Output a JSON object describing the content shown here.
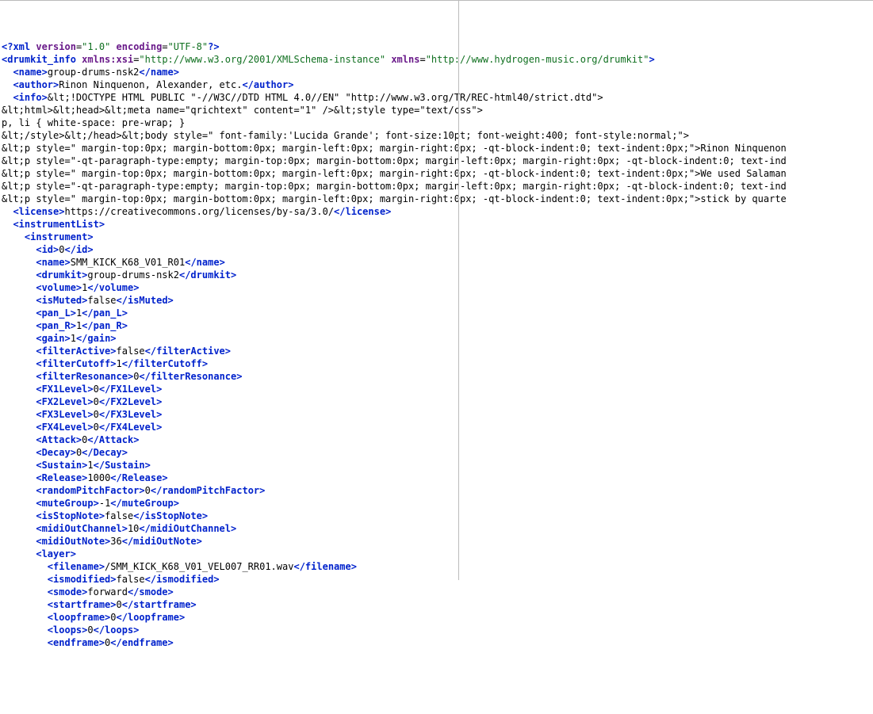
{
  "lines": [
    [
      {
        "c": "tag",
        "t": "<?xml"
      },
      {
        "c": "txt",
        "t": " "
      },
      {
        "c": "attr",
        "t": "version"
      },
      {
        "c": "txt",
        "t": "="
      },
      {
        "c": "str",
        "t": "\"1.0\""
      },
      {
        "c": "txt",
        "t": " "
      },
      {
        "c": "attr",
        "t": "encoding"
      },
      {
        "c": "txt",
        "t": "="
      },
      {
        "c": "str",
        "t": "\"UTF-8\""
      },
      {
        "c": "tag",
        "t": "?>"
      }
    ],
    [
      {
        "c": "tag",
        "t": "<drumkit_info"
      },
      {
        "c": "txt",
        "t": " "
      },
      {
        "c": "attr",
        "t": "xmlns:xsi"
      },
      {
        "c": "txt",
        "t": "="
      },
      {
        "c": "str",
        "t": "\"http://www.w3.org/2001/XMLSchema-instance\""
      },
      {
        "c": "txt",
        "t": " "
      },
      {
        "c": "attr",
        "t": "xmlns"
      },
      {
        "c": "txt",
        "t": "="
      },
      {
        "c": "str",
        "t": "\"http://www.hydrogen-music.org/drumkit\""
      },
      {
        "c": "tag",
        "t": ">"
      }
    ],
    [
      {
        "c": "txt",
        "t": "  "
      },
      {
        "c": "tag",
        "t": "<name>"
      },
      {
        "c": "txt",
        "t": "group-drums-nsk2"
      },
      {
        "c": "tag",
        "t": "</name>"
      }
    ],
    [
      {
        "c": "txt",
        "t": "  "
      },
      {
        "c": "tag",
        "t": "<author>"
      },
      {
        "c": "txt",
        "t": "Rinon Ninquenon, Alexander, etc."
      },
      {
        "c": "tag",
        "t": "</author>"
      }
    ],
    [
      {
        "c": "txt",
        "t": "  "
      },
      {
        "c": "tag",
        "t": "<info>"
      },
      {
        "c": "txt",
        "t": "&lt;!DOCTYPE HTML PUBLIC \"-//W3C//DTD HTML 4.0//EN\" \"http://www.w3.org/TR/REC-html40/strict.dtd\">"
      }
    ],
    [
      {
        "c": "txt",
        "t": "&lt;html>&lt;head>&lt;meta name=\"qrichtext\" content=\"1\" />&lt;style type=\"text/css\">"
      }
    ],
    [
      {
        "c": "txt",
        "t": "p, li { white-space: pre-wrap; }"
      }
    ],
    [
      {
        "c": "txt",
        "t": "&lt;/style>&lt;/head>&lt;body style=\" font-family:'Lucida Grande'; font-size:10pt; font-weight:400; font-style:normal;\">"
      }
    ],
    [
      {
        "c": "txt",
        "t": "&lt;p style=\" margin-top:0px; margin-bottom:0px; margin-left:0px; margin-right:0px; -qt-block-indent:0; text-indent:0px;\">Rinon Ninquenon"
      }
    ],
    [
      {
        "c": "txt",
        "t": "&lt;p style=\"-qt-paragraph-type:empty; margin-top:0px; margin-bottom:0px; margin-left:0px; margin-right:0px; -qt-block-indent:0; text-ind"
      }
    ],
    [
      {
        "c": "txt",
        "t": "&lt;p style=\" margin-top:0px; margin-bottom:0px; margin-left:0px; margin-right:0px; -qt-block-indent:0; text-indent:0px;\">We used Salaman"
      }
    ],
    [
      {
        "c": "txt",
        "t": "&lt;p style=\"-qt-paragraph-type:empty; margin-top:0px; margin-bottom:0px; margin-left:0px; margin-right:0px; -qt-block-indent:0; text-ind"
      }
    ],
    [
      {
        "c": "txt",
        "t": "&lt;p style=\" margin-top:0px; margin-bottom:0px; margin-left:0px; margin-right:0px; -qt-block-indent:0; text-indent:0px;\">stick by quarte"
      }
    ],
    [
      {
        "c": "txt",
        "t": "  "
      },
      {
        "c": "tag",
        "t": "<license>"
      },
      {
        "c": "txt",
        "t": "https://creativecommons.org/licenses/by-sa/3.0/"
      },
      {
        "c": "tag",
        "t": "</license>"
      }
    ],
    [
      {
        "c": "txt",
        "t": "  "
      },
      {
        "c": "tag",
        "t": "<instrumentList>"
      }
    ],
    [
      {
        "c": "txt",
        "t": "    "
      },
      {
        "c": "tag",
        "t": "<instrument>"
      }
    ],
    [
      {
        "c": "txt",
        "t": "      "
      },
      {
        "c": "tag",
        "t": "<id>"
      },
      {
        "c": "txt",
        "t": "0"
      },
      {
        "c": "tag",
        "t": "</id>"
      }
    ],
    [
      {
        "c": "txt",
        "t": "      "
      },
      {
        "c": "tag",
        "t": "<name>"
      },
      {
        "c": "txt",
        "t": "SMM_KICK_K68_V01_R01"
      },
      {
        "c": "tag",
        "t": "</name>"
      }
    ],
    [
      {
        "c": "txt",
        "t": "      "
      },
      {
        "c": "tag",
        "t": "<drumkit>"
      },
      {
        "c": "txt",
        "t": "group-drums-nsk2"
      },
      {
        "c": "tag",
        "t": "</drumkit>"
      }
    ],
    [
      {
        "c": "txt",
        "t": "      "
      },
      {
        "c": "tag",
        "t": "<volume>"
      },
      {
        "c": "txt",
        "t": "1"
      },
      {
        "c": "tag",
        "t": "</volume>"
      }
    ],
    [
      {
        "c": "txt",
        "t": "      "
      },
      {
        "c": "tag",
        "t": "<isMuted>"
      },
      {
        "c": "txt",
        "t": "false"
      },
      {
        "c": "tag",
        "t": "</isMuted>"
      }
    ],
    [
      {
        "c": "txt",
        "t": "      "
      },
      {
        "c": "tag",
        "t": "<pan_L>"
      },
      {
        "c": "txt",
        "t": "1"
      },
      {
        "c": "tag",
        "t": "</pan_L>"
      }
    ],
    [
      {
        "c": "txt",
        "t": "      "
      },
      {
        "c": "tag",
        "t": "<pan_R>"
      },
      {
        "c": "txt",
        "t": "1"
      },
      {
        "c": "tag",
        "t": "</pan_R>"
      }
    ],
    [
      {
        "c": "txt",
        "t": "      "
      },
      {
        "c": "tag",
        "t": "<gain>"
      },
      {
        "c": "txt",
        "t": "1"
      },
      {
        "c": "tag",
        "t": "</gain>"
      }
    ],
    [
      {
        "c": "txt",
        "t": "      "
      },
      {
        "c": "tag",
        "t": "<filterActive>"
      },
      {
        "c": "txt",
        "t": "false"
      },
      {
        "c": "tag",
        "t": "</filterActive>"
      }
    ],
    [
      {
        "c": "txt",
        "t": "      "
      },
      {
        "c": "tag",
        "t": "<filterCutoff>"
      },
      {
        "c": "txt",
        "t": "1"
      },
      {
        "c": "tag",
        "t": "</filterCutoff>"
      }
    ],
    [
      {
        "c": "txt",
        "t": "      "
      },
      {
        "c": "tag",
        "t": "<filterResonance>"
      },
      {
        "c": "txt",
        "t": "0"
      },
      {
        "c": "tag",
        "t": "</filterResonance>"
      }
    ],
    [
      {
        "c": "txt",
        "t": "      "
      },
      {
        "c": "tag",
        "t": "<FX1Level>"
      },
      {
        "c": "txt",
        "t": "0"
      },
      {
        "c": "tag",
        "t": "</FX1Level>"
      }
    ],
    [
      {
        "c": "txt",
        "t": "      "
      },
      {
        "c": "tag",
        "t": "<FX2Level>"
      },
      {
        "c": "txt",
        "t": "0"
      },
      {
        "c": "tag",
        "t": "</FX2Level>"
      }
    ],
    [
      {
        "c": "txt",
        "t": "      "
      },
      {
        "c": "tag",
        "t": "<FX3Level>"
      },
      {
        "c": "txt",
        "t": "0"
      },
      {
        "c": "tag",
        "t": "</FX3Level>"
      }
    ],
    [
      {
        "c": "txt",
        "t": "      "
      },
      {
        "c": "tag",
        "t": "<FX4Level>"
      },
      {
        "c": "txt",
        "t": "0"
      },
      {
        "c": "tag",
        "t": "</FX4Level>"
      }
    ],
    [
      {
        "c": "txt",
        "t": "      "
      },
      {
        "c": "tag",
        "t": "<Attack>"
      },
      {
        "c": "txt",
        "t": "0"
      },
      {
        "c": "tag",
        "t": "</Attack>"
      }
    ],
    [
      {
        "c": "txt",
        "t": "      "
      },
      {
        "c": "tag",
        "t": "<Decay>"
      },
      {
        "c": "txt",
        "t": "0"
      },
      {
        "c": "tag",
        "t": "</Decay>"
      }
    ],
    [
      {
        "c": "txt",
        "t": "      "
      },
      {
        "c": "tag",
        "t": "<Sustain>"
      },
      {
        "c": "txt",
        "t": "1"
      },
      {
        "c": "tag",
        "t": "</Sustain>"
      }
    ],
    [
      {
        "c": "txt",
        "t": "      "
      },
      {
        "c": "tag",
        "t": "<Release>"
      },
      {
        "c": "txt",
        "t": "1000"
      },
      {
        "c": "tag",
        "t": "</Release>"
      }
    ],
    [
      {
        "c": "txt",
        "t": "      "
      },
      {
        "c": "tag",
        "t": "<randomPitchFactor>"
      },
      {
        "c": "txt",
        "t": "0"
      },
      {
        "c": "tag",
        "t": "</randomPitchFactor>"
      }
    ],
    [
      {
        "c": "txt",
        "t": "      "
      },
      {
        "c": "tag",
        "t": "<muteGroup>"
      },
      {
        "c": "txt",
        "t": "-1"
      },
      {
        "c": "tag",
        "t": "</muteGroup>"
      }
    ],
    [
      {
        "c": "txt",
        "t": "      "
      },
      {
        "c": "tag",
        "t": "<isStopNote>"
      },
      {
        "c": "txt",
        "t": "false"
      },
      {
        "c": "tag",
        "t": "</isStopNote>"
      }
    ],
    [
      {
        "c": "txt",
        "t": "      "
      },
      {
        "c": "tag",
        "t": "<midiOutChannel>"
      },
      {
        "c": "txt",
        "t": "10"
      },
      {
        "c": "tag",
        "t": "</midiOutChannel>"
      }
    ],
    [
      {
        "c": "txt",
        "t": "      "
      },
      {
        "c": "tag",
        "t": "<midiOutNote>"
      },
      {
        "c": "txt",
        "t": "36"
      },
      {
        "c": "tag",
        "t": "</midiOutNote>"
      }
    ],
    [
      {
        "c": "txt",
        "t": "      "
      },
      {
        "c": "tag",
        "t": "<layer>"
      }
    ],
    [
      {
        "c": "txt",
        "t": "        "
      },
      {
        "c": "tag",
        "t": "<filename>"
      },
      {
        "c": "txt",
        "t": "/SMM_KICK_K68_V01_VEL007_RR01.wav"
      },
      {
        "c": "tag",
        "t": "</filename>"
      }
    ],
    [
      {
        "c": "txt",
        "t": "        "
      },
      {
        "c": "tag",
        "t": "<ismodified>"
      },
      {
        "c": "txt",
        "t": "false"
      },
      {
        "c": "tag",
        "t": "</ismodified>"
      }
    ],
    [
      {
        "c": "txt",
        "t": "        "
      },
      {
        "c": "tag",
        "t": "<smode>"
      },
      {
        "c": "txt",
        "t": "forward"
      },
      {
        "c": "tag",
        "t": "</smode>"
      }
    ],
    [
      {
        "c": "txt",
        "t": "        "
      },
      {
        "c": "tag",
        "t": "<startframe>"
      },
      {
        "c": "txt",
        "t": "0"
      },
      {
        "c": "tag",
        "t": "</startframe>"
      }
    ],
    [
      {
        "c": "txt",
        "t": "        "
      },
      {
        "c": "tag",
        "t": "<loopframe>"
      },
      {
        "c": "txt",
        "t": "0"
      },
      {
        "c": "tag",
        "t": "</loopframe>"
      }
    ],
    [
      {
        "c": "txt",
        "t": "        "
      },
      {
        "c": "tag",
        "t": "<loops>"
      },
      {
        "c": "txt",
        "t": "0"
      },
      {
        "c": "tag",
        "t": "</loops>"
      }
    ],
    [
      {
        "c": "txt",
        "t": "        "
      },
      {
        "c": "tag",
        "t": "<endframe>"
      },
      {
        "c": "txt",
        "t": "0"
      },
      {
        "c": "tag",
        "t": "</endframe>"
      }
    ]
  ]
}
